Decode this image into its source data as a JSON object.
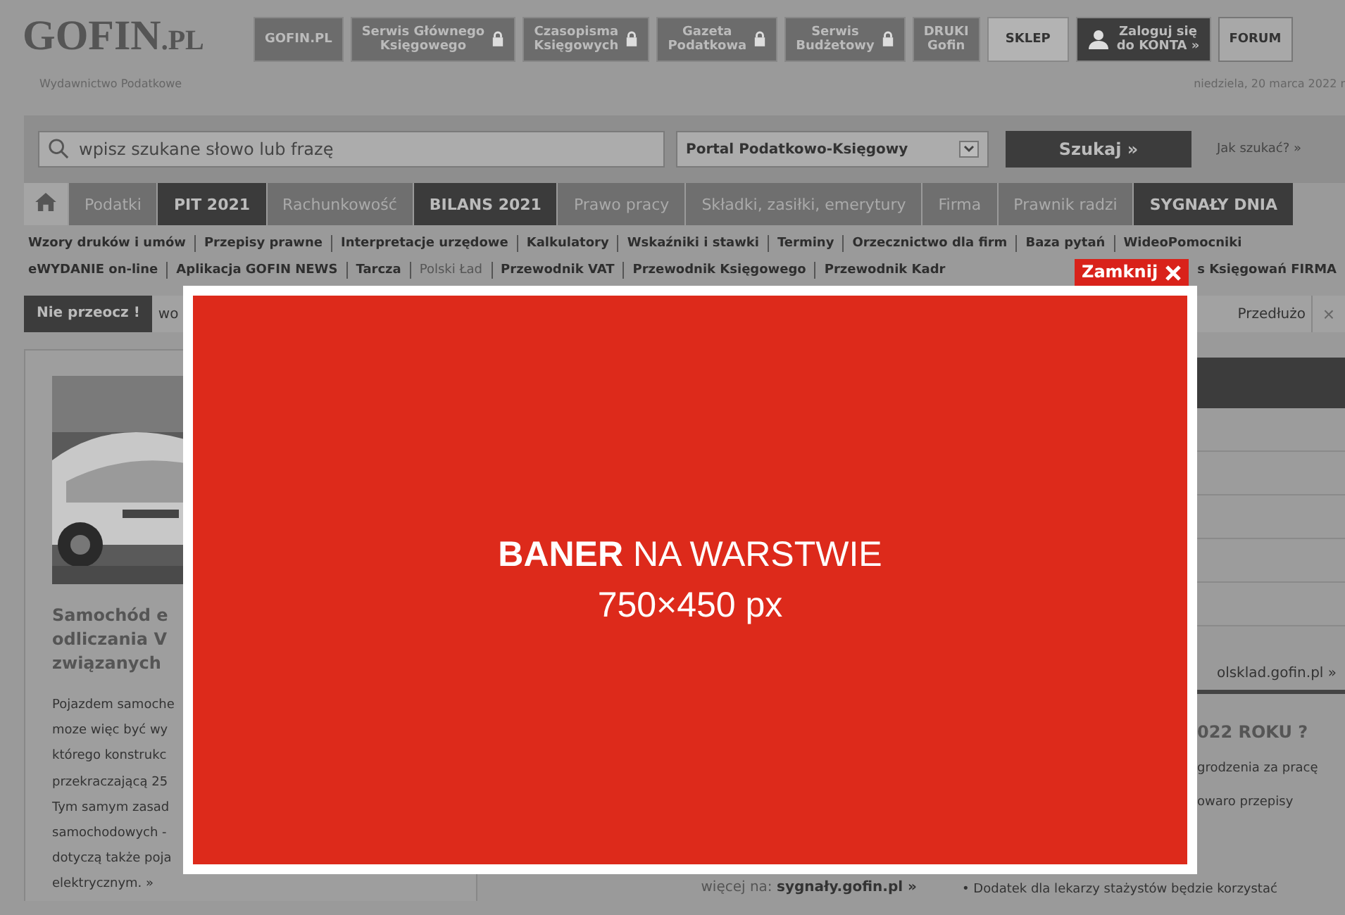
{
  "logo": {
    "main": "GOFIN",
    "suffix": ".PL"
  },
  "tagline": "Wydawnictwo Podatkowe",
  "date": "niedziela, 20 marca 2022 r",
  "nav": [
    {
      "lines": [
        "GOFIN.PL"
      ],
      "kind": "plain",
      "locked": false
    },
    {
      "lines": [
        "Serwis Głównego",
        "Księgowego"
      ],
      "kind": "plain",
      "locked": true
    },
    {
      "lines": [
        "Czasopisma",
        "Księgowych"
      ],
      "kind": "plain",
      "locked": true
    },
    {
      "lines": [
        "Gazeta",
        "Podatkowa"
      ],
      "kind": "plain",
      "locked": true
    },
    {
      "lines": [
        "Serwis",
        "Budżetowy"
      ],
      "kind": "plain",
      "locked": true
    },
    {
      "lines": [
        "DRUKI",
        "Gofin"
      ],
      "kind": "plain",
      "locked": false
    },
    {
      "lines": [
        "SKLEP"
      ],
      "kind": "light",
      "locked": false
    },
    {
      "lines": [
        "Zaloguj się",
        "do KONTA »"
      ],
      "kind": "account",
      "locked": false
    },
    {
      "lines": [
        "FORUM"
      ],
      "kind": "outline",
      "locked": false
    }
  ],
  "search": {
    "placeholder": "wpisz szukane słowo lub frazę",
    "portal": "Portal Podatkowo-Księgowy",
    "button": "Szukaj »",
    "help": "Jak szukać? »"
  },
  "menu": [
    {
      "label": "Podatki",
      "kind": "regular"
    },
    {
      "label": "PIT 2021",
      "kind": "featured"
    },
    {
      "label": "Rachunkowość",
      "kind": "regular"
    },
    {
      "label": "BILANS 2021",
      "kind": "featured"
    },
    {
      "label": "Prawo pracy",
      "kind": "regular"
    },
    {
      "label": "Składki, zasiłki, emerytury",
      "kind": "regular"
    },
    {
      "label": "Firma",
      "kind": "regular"
    },
    {
      "label": "Prawnik radzi",
      "kind": "regular"
    },
    {
      "label": "SYGNAŁY DNIA",
      "kind": "featured"
    }
  ],
  "links_1": [
    {
      "label": "Wzory druków i umów",
      "muted": false
    },
    {
      "label": "Przepisy prawne",
      "muted": false
    },
    {
      "label": "Interpretacje urzędowe",
      "muted": false
    },
    {
      "label": "Kalkulatory",
      "muted": false
    },
    {
      "label": "Wskaźniki i stawki",
      "muted": false
    },
    {
      "label": "Terminy",
      "muted": false
    },
    {
      "label": "Orzecznictwo dla firm",
      "muted": false
    },
    {
      "label": "Baza pytań",
      "muted": false
    },
    {
      "label": "WideoPomocniki",
      "muted": false
    }
  ],
  "links_2": [
    {
      "label": "eWYDANIE on-line",
      "muted": false
    },
    {
      "label": "Aplikacja GOFIN NEWS",
      "muted": false
    },
    {
      "label": "Tarcza",
      "muted": false
    },
    {
      "label": "Polski Ład",
      "muted": true
    },
    {
      "label": "Przewodnik VAT",
      "muted": false
    },
    {
      "label": "Przewodnik Księgowego",
      "muted": false
    },
    {
      "label": "Przewodnik Kadr",
      "muted": false
    },
    {
      "label": "s Księgowań FIRMA",
      "muted": false
    }
  ],
  "ticker": {
    "label": "Nie przeocz !",
    "text_left": "wo",
    "text_right": "Przedłużo",
    "close": "×"
  },
  "article": {
    "title_lines": [
      "Samochód e",
      "odliczania V",
      "związanych"
    ],
    "body_lines": [
      "Pojazdem samoche",
      "moze więc być wy",
      "którego konstrukc",
      "przekraczającą 25",
      "Tym samym zasad",
      "samochodowych -",
      "dotyczą także poja",
      "elektrycznym. »"
    ]
  },
  "more": {
    "label": "więcej na:",
    "link": "sygnały.gofin.pl »"
  },
  "side": {
    "link": "olsklad.gofin.pl »",
    "heading": "022 ROKU ?",
    "lines": [
      "grodzenia za pracę",
      "owaro przepisy"
    ],
    "bottom": "• Dodatek dla lekarzy stażystów będzie korzystać"
  },
  "banner": {
    "close": "Zamknij",
    "title": "**BANER** NA WARSTWIE",
    "size": "750×450 px"
  }
}
